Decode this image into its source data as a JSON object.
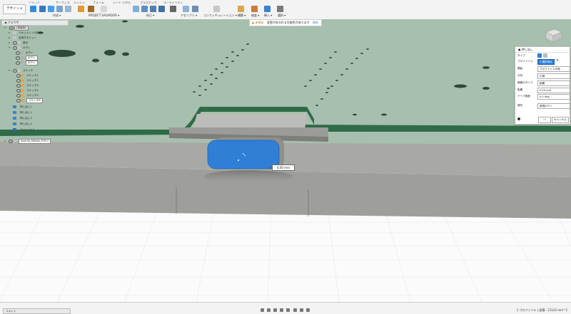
{
  "toolbar": {
    "workspace": "デザイン ▾",
    "tabs": [
      "ソリッド",
      "サーフェス",
      "メッシュ",
      "フォーム",
      "シート メタル",
      "プラスチック",
      "ユーティリティ"
    ],
    "groups": [
      "作成 ▾",
      "PROJECT SALVADOR ▾",
      "修正 ▾",
      "アセンブリ ▾",
      "コンフィギュレーション ▾",
      "構築 ▾",
      "検査 ▾",
      "挿入 ▾",
      "選択 ▾"
    ]
  },
  "browser": {
    "title": "ブラウザ",
    "root": "(未保存)",
    "items": [
      "ドキュメントの設定",
      "名前付きビュー",
      "原点",
      "ボディ",
      "スケッチ",
      "スケッチ1",
      "スケッチ2",
      "スケッチ3",
      "スケッチ4",
      "スケッチ5",
      "スケッチ6",
      "押し出し1",
      "押し出し2",
      "押し出し3",
      "押し出し4",
      "フィレット1",
      "Akacha_Mobile_PCB:1"
    ],
    "body_items": [
      "ボディ",
      "ボディ",
      "ボディ"
    ]
  },
  "warning": {
    "label": "▲ 未保存:",
    "message": "変更が失われる可能性があります",
    "action": "保存"
  },
  "dialog": {
    "title": "● 押し出し",
    "type_label": "タイプ",
    "profile_label": "プロファイル",
    "profile_value": "1 選択済み",
    "start_label": "開始",
    "start_value": "プロファイル平面",
    "direction_label": "方向",
    "direction_value": "片側",
    "extent_label": "範囲のタイプ",
    "extent_value": "距離",
    "distance_label": "距離",
    "distance_value": "0.00 mm",
    "taper_label": "テーパ角度",
    "taper_value": "0.0 deg",
    "operation_label": "操作",
    "operation_value": "新規ボディ",
    "ok_label": "OK",
    "cancel_label": "キャンセル"
  },
  "dimension": {
    "value": "0.00 mm"
  },
  "bottom": {
    "comments": "コメント",
    "status": "1 プロファイル | 面積 : 21142 mm^2"
  }
}
